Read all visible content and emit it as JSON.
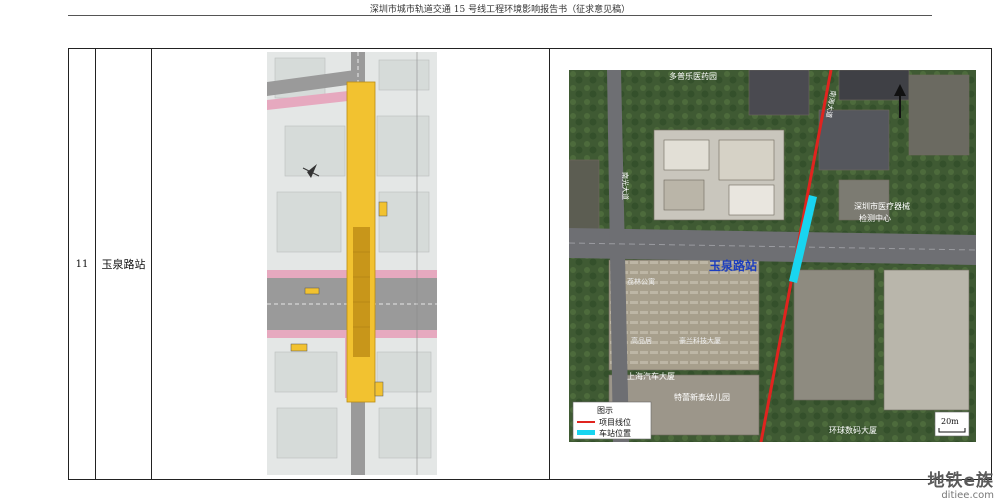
{
  "header": {
    "title": "深圳市城市轨道交通 15 号线工程环境影响报告书（征求意见稿）"
  },
  "row": {
    "index": "11",
    "station_name": "玉泉路站"
  },
  "plan_drawing": {
    "colors": {
      "station": "#f2c230",
      "station_core": "#c8961a",
      "road": "#9a9a9a",
      "sidewalk": "#e6a9bf",
      "block": "#e4e7e6"
    }
  },
  "satellite_map": {
    "labels": {
      "pharmacy": "多普乐医药园",
      "road_vertical_1": "南光大道",
      "road_vertical_2": "南海大道",
      "medical_center_1": "深圳市医疗器械",
      "medical_center_2": "检测中心",
      "road_main": "玉泉路站",
      "garden": "荔林公寓",
      "gaopin": "高品居",
      "gaolan": "豪兰科技大厦",
      "shanghai": "上海汽车大厦",
      "kindergarten": "特蕾新泰幼儿园",
      "global_digital": "环球数码大厦"
    },
    "legend": {
      "title": "图示",
      "line_label": "项目线位",
      "station_label": "车站位置",
      "line_color": "#e0241f",
      "station_color": "#19d5f0"
    },
    "scale_label": "20m"
  },
  "watermark": {
    "text": "地铁e族",
    "url": "ditiee.com"
  }
}
